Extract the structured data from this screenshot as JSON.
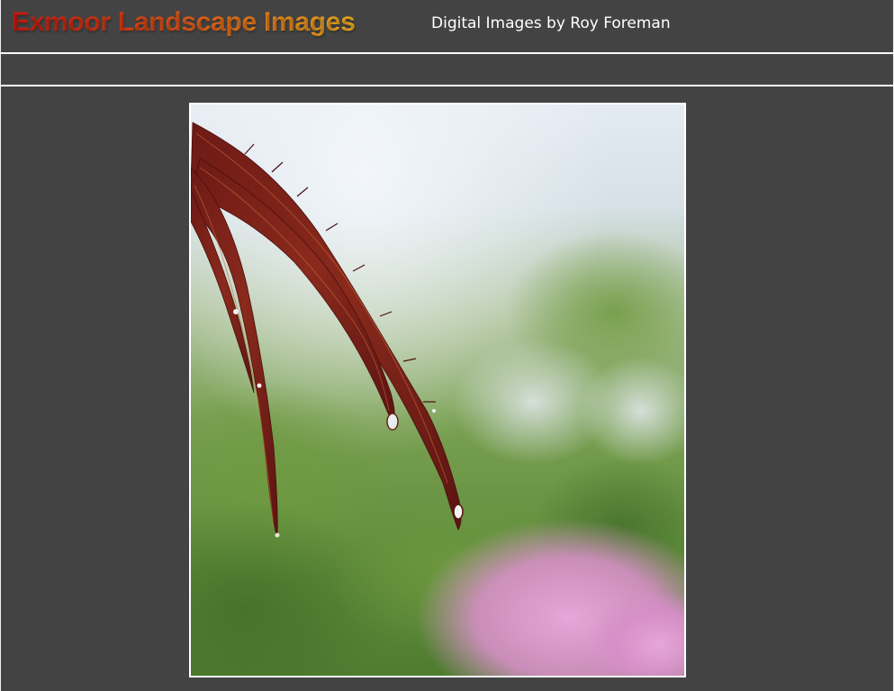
{
  "header": {
    "title": "Exmoor Landscape Images",
    "subtitle": "Digital Images by Roy Foreman"
  },
  "colors": {
    "background": "#434343",
    "rule": "#ffffff",
    "subtitle_text": "#ffffff",
    "title_gradient_start": "#c81c12",
    "title_gradient_end": "#f0b020"
  }
}
